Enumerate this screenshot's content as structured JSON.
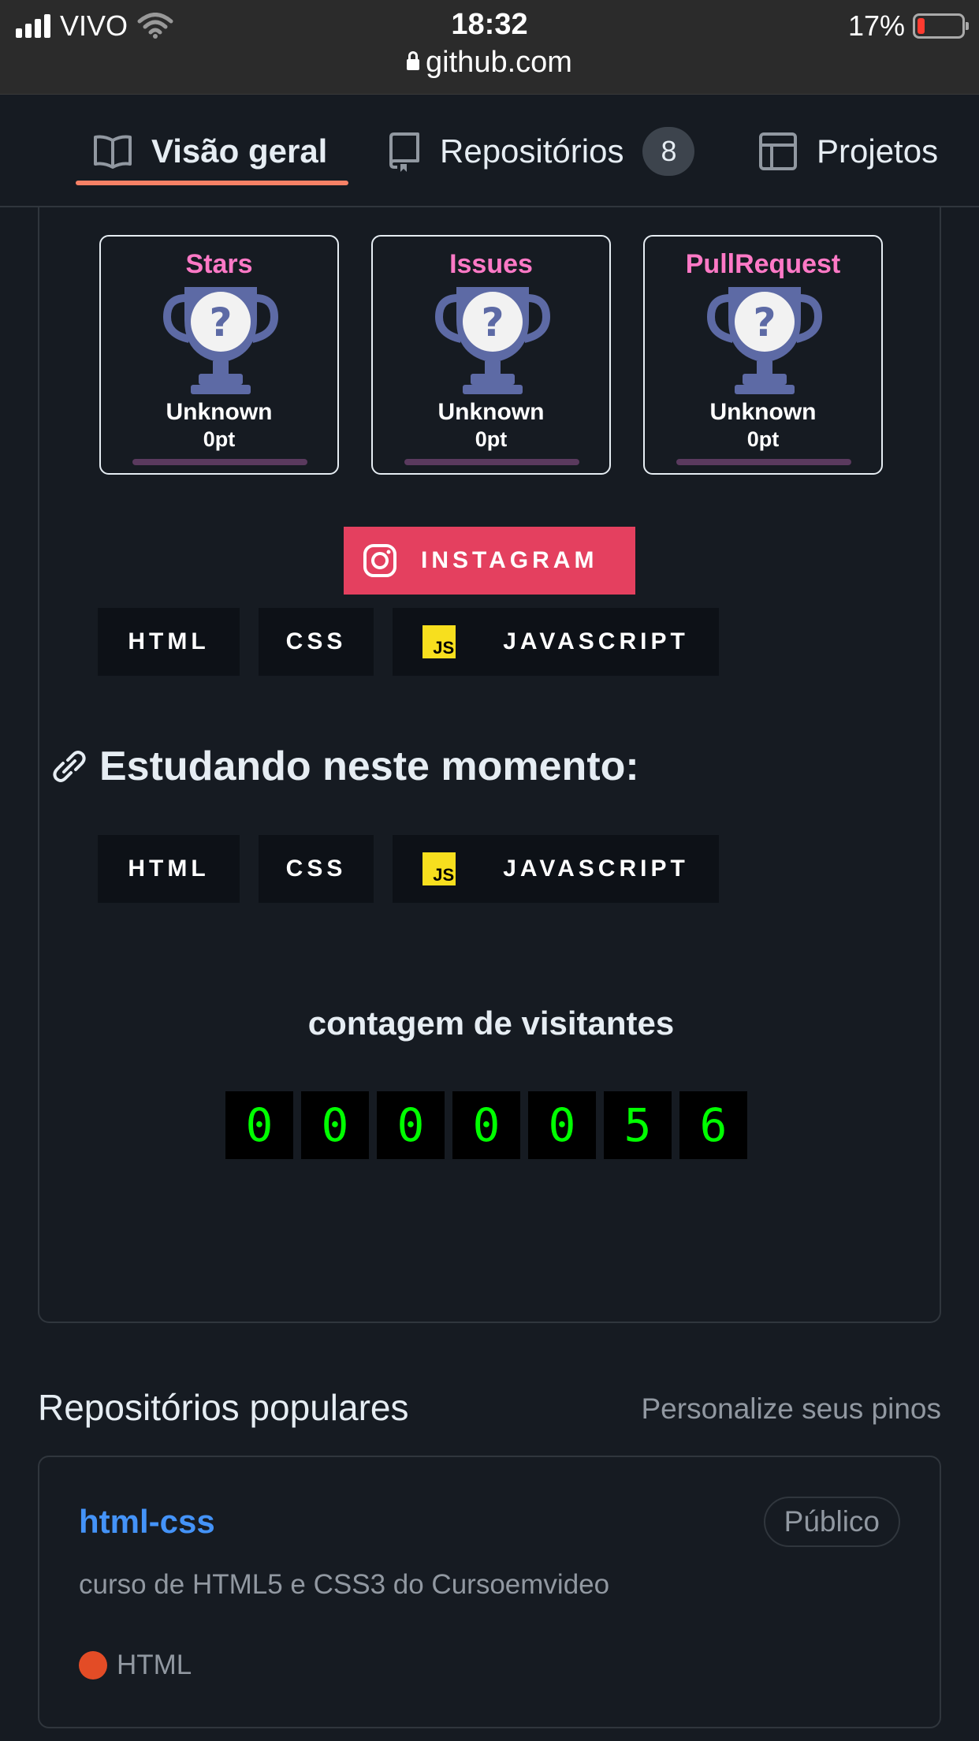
{
  "status_bar": {
    "carrier": "VIVO",
    "time": "18:32",
    "url": "github.com",
    "battery": "17%"
  },
  "tabs": [
    {
      "label": "Visão geral"
    },
    {
      "label": "Repositórios",
      "count": "8"
    },
    {
      "label": "Projetos"
    }
  ],
  "trophies": [
    {
      "title": "Stars",
      "rank": "Unknown",
      "points": "0pt"
    },
    {
      "title": "Issues",
      "rank": "Unknown",
      "points": "0pt"
    },
    {
      "title": "PullRequest",
      "rank": "Unknown",
      "points": "0pt"
    }
  ],
  "instagram_label": "INSTAGRAM",
  "badges": {
    "html": "HTML",
    "css": "CSS",
    "js_logo": "JS",
    "javascript": "JAVASCRIPT"
  },
  "studying_heading": "Estudando neste momento:",
  "visitor": {
    "title": "contagem de visitantes",
    "digits": [
      "0",
      "0",
      "0",
      "0",
      "0",
      "5",
      "6"
    ]
  },
  "popular": {
    "title": "Repositórios populares",
    "customize": "Personalize seus pinos",
    "repo": {
      "name": "html-css",
      "visibility": "Público",
      "description": "curso de HTML5 e CSS3 do Cursoemvideo",
      "language": "HTML",
      "language_color": "#e34c26"
    }
  },
  "colors": {
    "accent_underline": "#f78166",
    "trophy_title": "#ff79c6",
    "instagram": "#e4405f",
    "counter_digits": "#00ff00",
    "link": "#4493f8"
  }
}
